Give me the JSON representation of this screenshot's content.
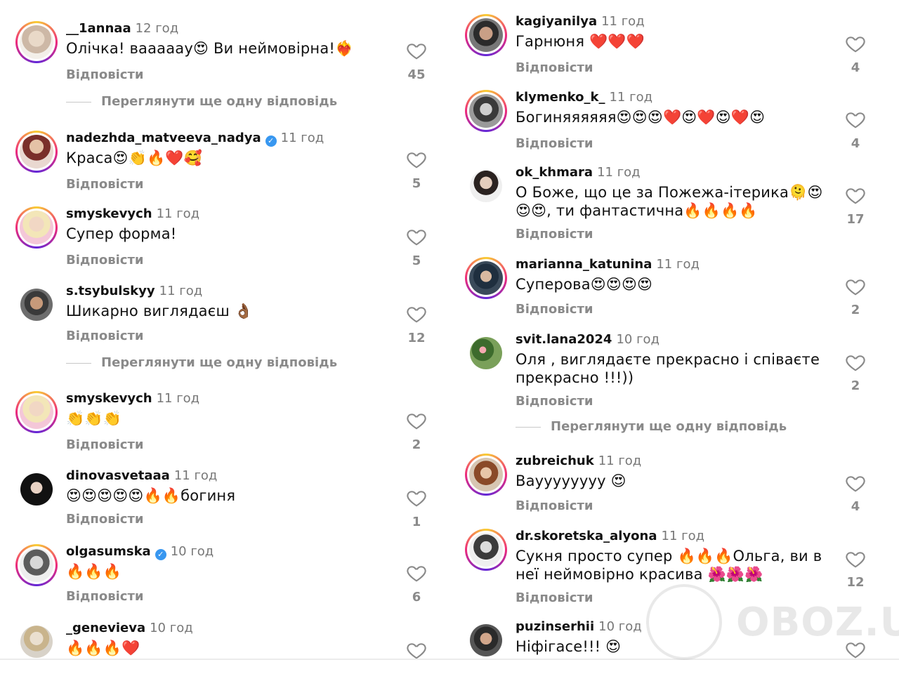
{
  "ui": {
    "reply_label": "Відповісти",
    "more_replies_label": "Переглянути ще одну відповідь",
    "verified_mark": "✓"
  },
  "left_comments": [
    {
      "username": "__1annaa",
      "time": "12 год",
      "text": "Олічка! вааааау😍 Ви неймовірна!❤️‍🔥",
      "likes": "45",
      "verified": false
    },
    {
      "username": "nadezhda_matveeva_nadya",
      "time": "11 год",
      "text": "Краса😍👏🔥❤️🥰",
      "likes": "5",
      "verified": true
    },
    {
      "username": "smyskevych",
      "time": "11 год",
      "text": "Супер форма!",
      "likes": "5",
      "verified": false
    },
    {
      "username": "s.tsybulskyy",
      "time": "11 год",
      "text": "Шикарно виглядаєш 👌🏾",
      "likes": "12",
      "verified": false
    },
    {
      "username": "smyskevych",
      "time": "11 год",
      "text": "👏👏👏",
      "likes": "2",
      "verified": false
    },
    {
      "username": "dinovasvetaaa",
      "time": "11 год",
      "text": "😍😍😍😍😍🔥🔥богиня",
      "likes": "1",
      "verified": false
    },
    {
      "username": "olgasumska",
      "time": "10 год",
      "text": "🔥🔥🔥",
      "likes": "6",
      "verified": true
    },
    {
      "username": "_genevieva",
      "time": "10 год",
      "text": "🔥🔥🔥❤️",
      "likes": "",
      "verified": false
    }
  ],
  "right_comments": [
    {
      "username": "kagiyanilya",
      "time": "11 год",
      "text": "Гарнюня ❤️❤️❤️",
      "likes": "4",
      "verified": false
    },
    {
      "username": "klymenko_k_",
      "time": "11 год",
      "text": "Богиняяяяяя😍😍😍❤️😍❤️😍❤️😍",
      "likes": "4",
      "verified": false
    },
    {
      "username": "ok_khmara",
      "time": "11 год",
      "text": "О Боже, що це  за Пожежа-ітерика🫠😍😍😍, ти фантастична🔥🔥🔥🔥",
      "likes": "17",
      "verified": false
    },
    {
      "username": "marianna_katunina",
      "time": "11 год",
      "text": "Суперова😍😍😍😍",
      "likes": "2",
      "verified": false
    },
    {
      "username": "svit.lana2024",
      "time": "10 год",
      "text": "Оля , виглядаєте прекрасно і співаєте прекрасно !!!))",
      "likes": "2",
      "verified": false
    },
    {
      "username": "zubreichuk",
      "time": "11 год",
      "text": "Вауууууууу 😍",
      "likes": "4",
      "verified": false
    },
    {
      "username": "dr.skoretska_alyona",
      "time": "11 год",
      "text": "Сукня просто супер 🔥🔥🔥Ольга, ви в неї неймовірно красива 🌺🌺🌺",
      "likes": "12",
      "verified": false
    },
    {
      "username": "puzinserhii",
      "time": "10 год",
      "text": "Ніфігасе!!! 😍",
      "likes": "",
      "verified": false
    }
  ],
  "watermark": {
    "text": "OBOZ.UA"
  },
  "colors": {
    "link_gray": "#8a8a8a",
    "verified": "#3897f0",
    "story_ring": "#ee2a7b"
  }
}
